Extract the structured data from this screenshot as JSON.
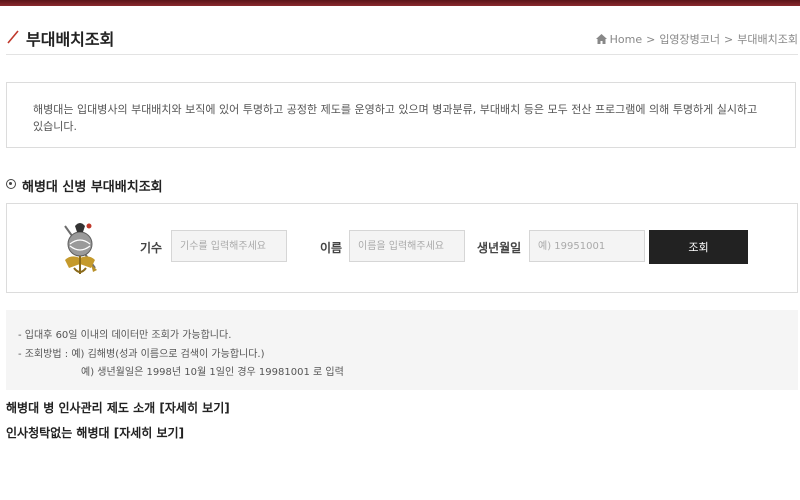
{
  "header": {
    "title": "부대배치조회",
    "breadcrumb": [
      "Home",
      "입영장병코너",
      "부대배치조회"
    ],
    "breadcrumb_sep": ">"
  },
  "intro": {
    "text": "해병대는 입대병사의 부대배치와 보직에 있어 투명하고 공정한 제도를 운영하고 있으며 병과분류, 부대배치 등은 모두 전산 프로그램에 의해 투명하게 실시하고 있습니다."
  },
  "section": {
    "title": "해병대 신병 부대배치조회"
  },
  "form": {
    "emblem_icon": "usmc-emblem-icon",
    "class_label": "기수",
    "class_placeholder": "기수를 입력해주세요",
    "name_label": "이름",
    "name_placeholder": "이름을 입력해주세요",
    "birth_label": "생년월일",
    "birth_placeholder": "예) 19951001",
    "submit_label": "조회",
    "button_color": "#222222"
  },
  "notice": {
    "line1": "- 입대후 60일 이내의 데이터만 조회가 가능합니다.",
    "line2": "- 조회방법 : 예) 김해병(성과 이름으로 검색이 가능합니다.)",
    "line3": "예) 생년월일은 1998년 10월 1일인 경우 19981001 로 입력"
  },
  "links": [
    {
      "text": "해병대 병 인사관리 제도 소개",
      "link_label": "[자세히 보기]"
    },
    {
      "text": "인사청탁없는 해병대",
      "link_label": "[자세히 보기]"
    }
  ],
  "colors": {
    "accent": "#8a2a2e",
    "title_slash": "#c0392b"
  }
}
